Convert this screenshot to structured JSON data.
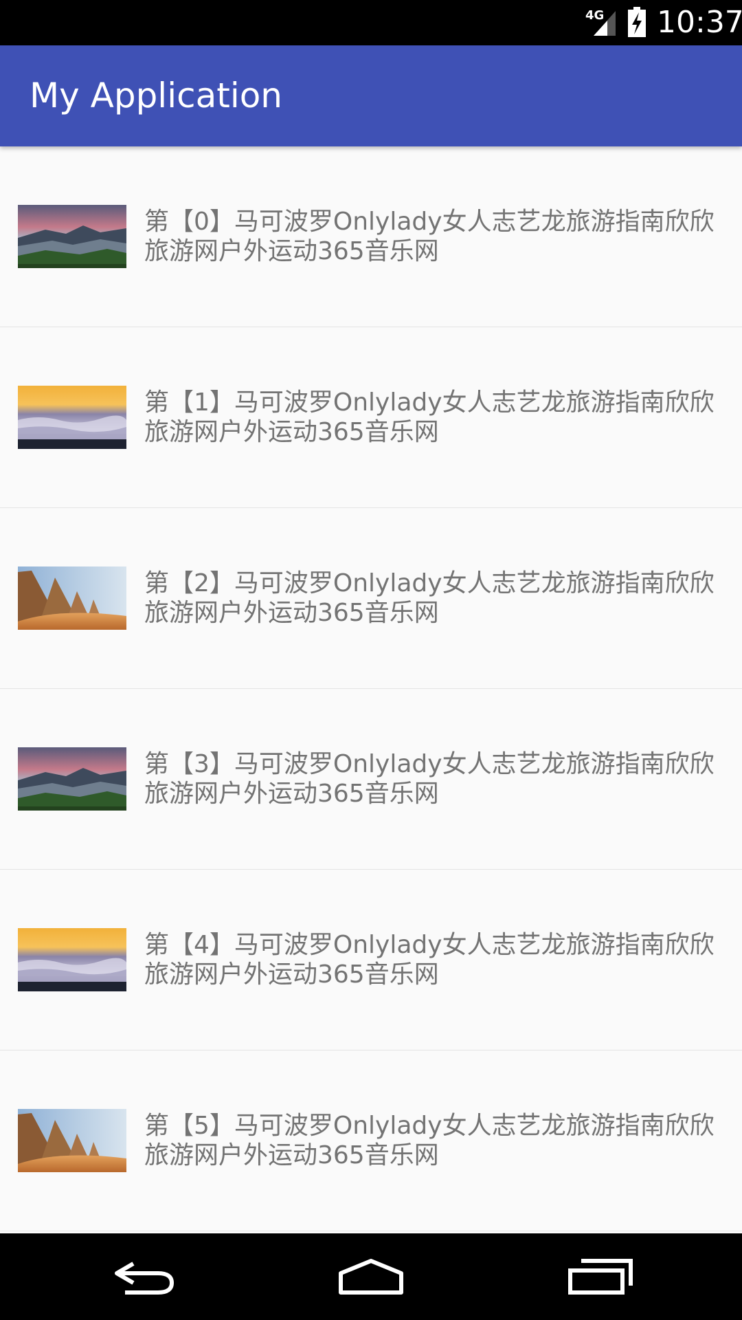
{
  "status_bar": {
    "network": "4G",
    "time": "10:37",
    "icons": [
      "signal-icon",
      "battery-charging-icon"
    ]
  },
  "app_bar": {
    "title": "My Application"
  },
  "list": {
    "items": [
      {
        "text": "第【0】马可波罗Onlylady女人志艺龙旅游指南欣欣旅游网户外运动365音乐网",
        "thumbnail": "mountain-landscape"
      },
      {
        "text": "第【1】马可波罗Onlylady女人志艺龙旅游指南欣欣旅游网户外运动365音乐网",
        "thumbnail": "sea-of-clouds-sunset"
      },
      {
        "text": "第【2】马可波罗Onlylady女人志艺龙旅游指南欣欣旅游网户外运动365音乐网",
        "thumbnail": "desert-pyramids"
      },
      {
        "text": "第【3】马可波罗Onlylady女人志艺龙旅游指南欣欣旅游网户外运动365音乐网",
        "thumbnail": "mountain-landscape"
      },
      {
        "text": "第【4】马可波罗Onlylady女人志艺龙旅游指南欣欣旅游网户外运动365音乐网",
        "thumbnail": "sea-of-clouds-sunset"
      },
      {
        "text": "第【5】马可波罗Onlylady女人志艺龙旅游指南欣欣旅游网户外运动365音乐网",
        "thumbnail": "desert-pyramids"
      }
    ]
  },
  "nav_bar": {
    "buttons": [
      "back-icon",
      "home-icon",
      "recents-icon"
    ]
  },
  "colors": {
    "primary": "#3f51b5",
    "background": "#fafafa",
    "text": "#737373",
    "divider": "#e4e4e4"
  }
}
